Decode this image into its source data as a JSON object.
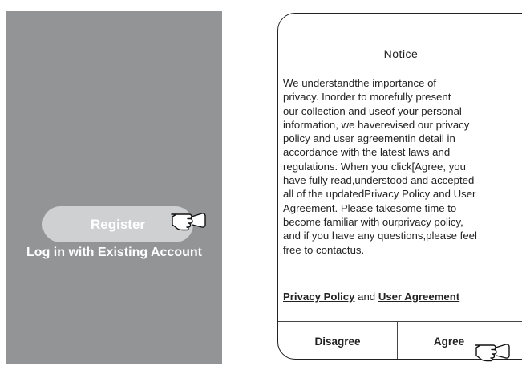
{
  "left_screen": {
    "register_label": "Register",
    "login_label": "Log in with Existing Account"
  },
  "notice": {
    "title": "Notice",
    "body": "We understandthe importance of\nprivacy. Inorder to morefully present\nour collection and useof your personal\ninformation, we haverevised our privacy\npolicy and user agreementin detail in\naccordance with the latest laws and\nregulations. When you click[Agree, you\nhave fully read,understood and accepted\nall of the updatedPrivacy Policy and User\nAgreement. Please takesome time to\nbecome familiar with ourprivacy policy,\nand if you have any questions,please feel\nfree to contactus.",
    "privacy_policy_link": "Privacy Policy",
    "and_text": "and",
    "user_agreement_link": "User Agreement",
    "disagree_label": "Disagree",
    "agree_label": "Agree"
  },
  "icons": {
    "pointer": "pointing-hand-icon"
  },
  "colors": {
    "left_screen_bg": "#939496",
    "register_button_bg": "#cfd0d2",
    "text_dark": "#222222"
  }
}
